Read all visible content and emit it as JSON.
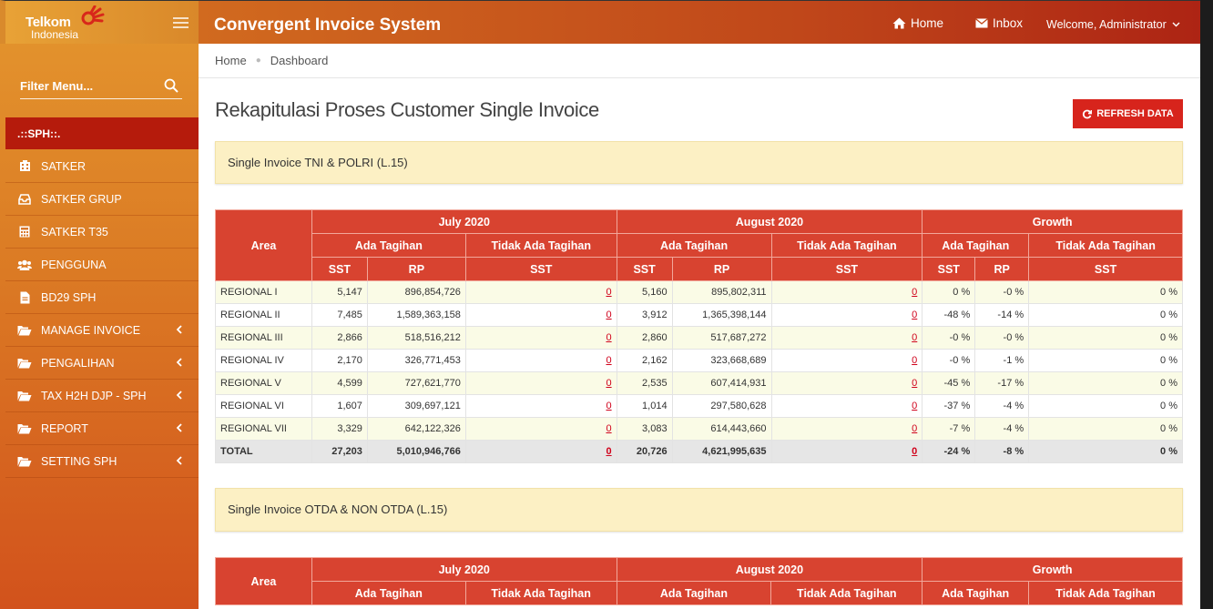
{
  "brand": {
    "logo_line1": "Telkom",
    "logo_line2": "Indonesia",
    "app_title": "Convergent Invoice System",
    "colors": {
      "accent": "#d7241c",
      "sidebar": "#de8428",
      "header": "#c0471a",
      "table_head": "#d84330",
      "panel": "#fcf0c4"
    }
  },
  "topnav": {
    "home": "Home",
    "inbox": "Inbox",
    "user": "Welcome, Administrator"
  },
  "sidebar": {
    "filter_placeholder": "Filter Menu...",
    "section": ".::SPH::.",
    "items": [
      {
        "label": "SATKER",
        "icon": "building-icon",
        "submenu": false
      },
      {
        "label": "SATKER GRUP",
        "icon": "inbox-icon",
        "submenu": false
      },
      {
        "label": "SATKER T35",
        "icon": "calculator-icon",
        "submenu": false
      },
      {
        "label": "PENGGUNA",
        "icon": "users-icon",
        "submenu": false
      },
      {
        "label": "BD29 SPH",
        "icon": "file-icon",
        "submenu": false
      },
      {
        "label": "MANAGE INVOICE",
        "icon": "folder-open-icon",
        "submenu": true
      },
      {
        "label": "PENGALIHAN",
        "icon": "folder-open-icon",
        "submenu": true
      },
      {
        "label": "TAX H2H DJP - SPH",
        "icon": "folder-open-icon",
        "submenu": true
      },
      {
        "label": "REPORT",
        "icon": "folder-open-icon",
        "submenu": true
      },
      {
        "label": "SETTING SPH",
        "icon": "folder-open-icon",
        "submenu": true
      }
    ]
  },
  "breadcrumb": [
    "Home",
    "Dashboard"
  ],
  "page": {
    "title": "Rekapitulasi Proses Customer Single Invoice",
    "refresh_label": "REFRESH DATA"
  },
  "headers": {
    "area": "Area",
    "month1": "July 2020",
    "month2": "August 2020",
    "growth": "Growth",
    "ada": "Ada Tagihan",
    "tidak": "Tidak Ada Tagihan",
    "sst": "SST",
    "rp": "RP"
  },
  "section1": {
    "panel_title": "Single Invoice TNI & POLRI (L.15)",
    "rows": [
      [
        "REGIONAL I",
        "5,147",
        "896,854,726",
        "0",
        "5,160",
        "895,802,311",
        "0",
        "0 %",
        "-0 %",
        "0 %"
      ],
      [
        "REGIONAL II",
        "7,485",
        "1,589,363,158",
        "0",
        "3,912",
        "1,365,398,144",
        "0",
        "-48 %",
        "-14 %",
        "0 %"
      ],
      [
        "REGIONAL III",
        "2,866",
        "518,516,212",
        "0",
        "2,860",
        "517,687,272",
        "0",
        "-0 %",
        "-0 %",
        "0 %"
      ],
      [
        "REGIONAL IV",
        "2,170",
        "326,771,453",
        "0",
        "2,162",
        "323,668,689",
        "0",
        "-0 %",
        "-1 %",
        "0 %"
      ],
      [
        "REGIONAL V",
        "4,599",
        "727,621,770",
        "0",
        "2,535",
        "607,414,931",
        "0",
        "-45 %",
        "-17 %",
        "0 %"
      ],
      [
        "REGIONAL VI",
        "1,607",
        "309,697,121",
        "0",
        "1,014",
        "297,580,628",
        "0",
        "-37 %",
        "-4 %",
        "0 %"
      ],
      [
        "REGIONAL VII",
        "3,329",
        "642,122,326",
        "0",
        "3,083",
        "614,443,660",
        "0",
        "-7 %",
        "-4 %",
        "0 %"
      ]
    ],
    "total": [
      "TOTAL",
      "27,203",
      "5,010,946,766",
      "0",
      "20,726",
      "4,621,995,635",
      "0",
      "-24 %",
      "-8 %",
      "0 %"
    ]
  },
  "section2": {
    "panel_title": "Single Invoice OTDA & NON OTDA (L.15)"
  }
}
